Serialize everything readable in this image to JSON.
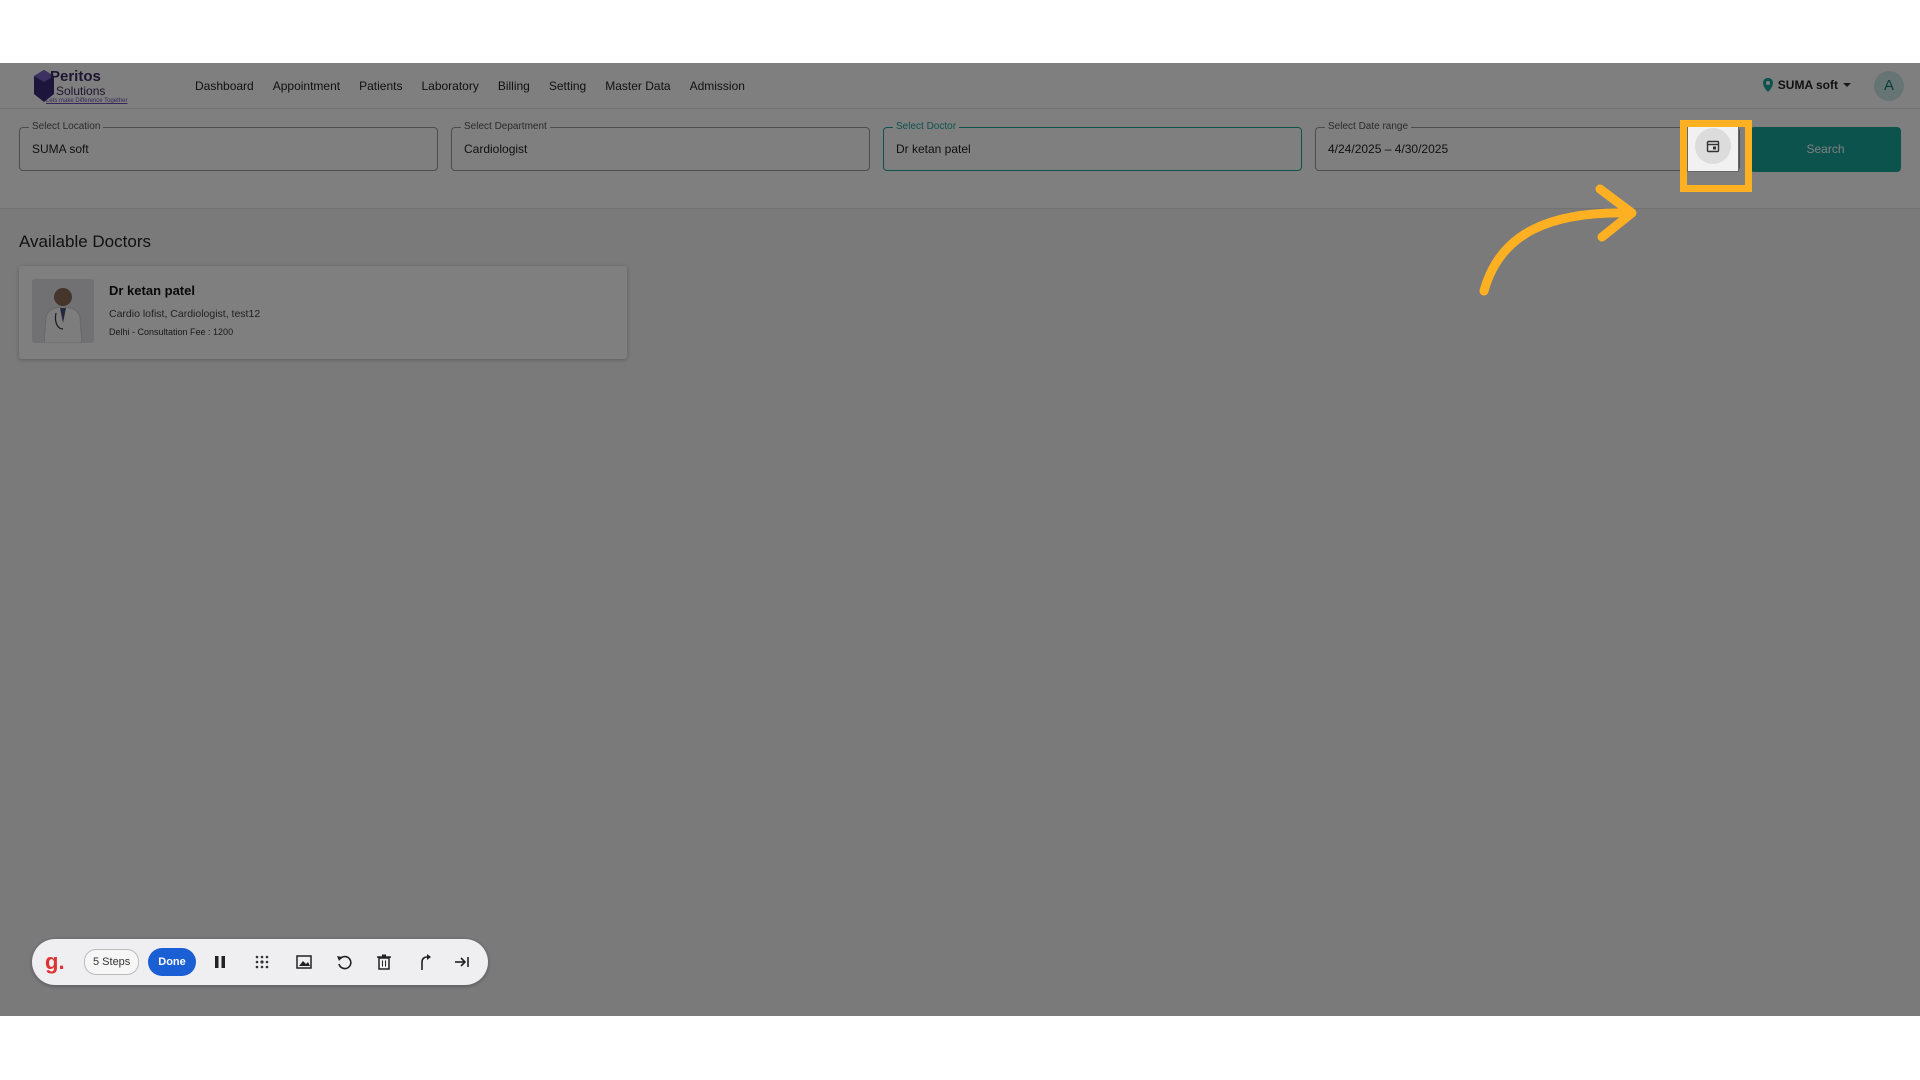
{
  "header": {
    "logo_name": "Peritos",
    "logo_sub": "Solutions",
    "logo_tagline": "Lets make Difference Together",
    "nav": [
      "Dashboard",
      "Appointment",
      "Patients",
      "Laboratory",
      "Billing",
      "Setting",
      "Master Data",
      "Admission"
    ],
    "location_label": "SUMA soft",
    "avatar_initial": "A"
  },
  "filters": {
    "location": {
      "label": "Select Location",
      "value": "SUMA soft"
    },
    "department": {
      "label": "Select Department",
      "value": "Cardiologist"
    },
    "doctor": {
      "label": "Select Doctor",
      "value": "Dr ketan patel"
    },
    "date_range": {
      "label": "Select Date range",
      "value": "4/24/2025 – 4/30/2025"
    },
    "search_label": "Search"
  },
  "content": {
    "section_title": "Available Doctors",
    "doctors": [
      {
        "name": "Dr ketan patel",
        "specialties": "Cardio lofist, Cardiologist, test12",
        "fee_line": "Delhi - Consultation Fee : 1200"
      }
    ]
  },
  "toolbar": {
    "logo": "g.",
    "steps_label": "5 Steps",
    "done_label": "Done",
    "icons": [
      "pause-icon",
      "blur-icon",
      "image-icon",
      "undo-icon",
      "trash-icon",
      "upload-icon",
      "skip-icon"
    ]
  },
  "colors": {
    "accent": "#1aa69a",
    "highlight": "#fdb022",
    "done_button": "#1b5fd4",
    "overlay": "rgba(0,0,0,0.5)"
  }
}
